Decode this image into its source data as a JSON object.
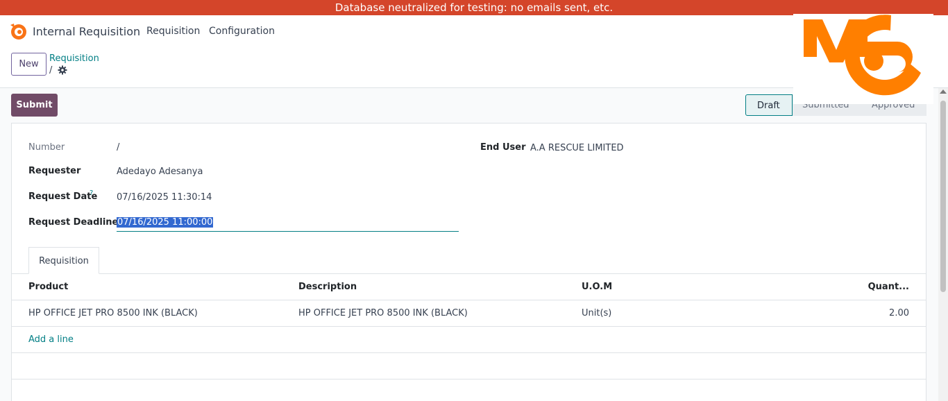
{
  "banner": {
    "text": "Database neutralized for testing: no emails sent, etc."
  },
  "navbar": {
    "app_name": "Internal Requisition",
    "menus": [
      "Requisition",
      "Configuration"
    ]
  },
  "control_panel": {
    "new_label": "New",
    "breadcrumb_link": "Requisition",
    "breadcrumb_current": "/"
  },
  "statusbar": {
    "submit_label": "Submit",
    "stages": [
      "Draft",
      "Submitted",
      "Approved"
    ],
    "active_stage": "Draft"
  },
  "form": {
    "number_label": "Number",
    "number_value": "/",
    "requester_label": "Requester",
    "requester_value": "Adedayo Adesanya",
    "request_date_label": "Request Date",
    "request_date_help": "?",
    "request_date_value": "07/16/2025 11:30:14",
    "deadline_label": "Request Deadline",
    "deadline_value": "07/16/2025 11:00:00",
    "end_user_label": "End User",
    "end_user_value": "A.A RESCUE LIMITED"
  },
  "tabs": [
    {
      "label": "Requisition"
    }
  ],
  "lines": {
    "headers": [
      "Product",
      "Description",
      "U.O.M",
      "Quant..."
    ],
    "rows": [
      [
        "HP OFFICE JET PRO 8500 INK (BLACK)",
        "HP OFFICE JET PRO 8500 INK (BLACK)",
        "Unit(s)",
        "2.00"
      ]
    ],
    "add_line_label": "Add a line"
  },
  "colors": {
    "banner": "#d4452a",
    "primary": "#714b67",
    "accent": "#017e84",
    "logo_orange": "#ff7f00"
  },
  "icons": [
    "odoo-app-icon",
    "gear-icon",
    "mg-logo"
  ]
}
